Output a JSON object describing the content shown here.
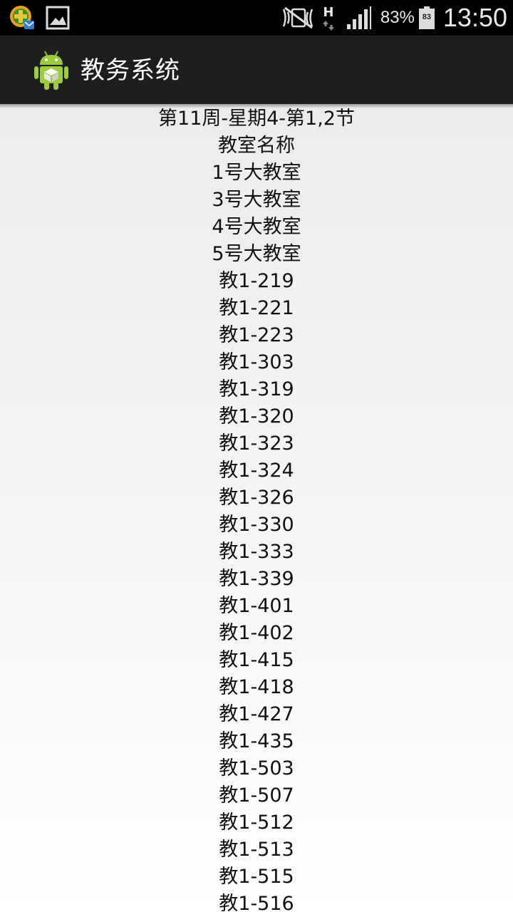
{
  "status_bar": {
    "battery_percent": "83%",
    "battery_level": "83",
    "network_type": "H",
    "time": "13:50",
    "icons": [
      "app-notification-icon",
      "gallery-notification-icon",
      "mute-icon",
      "network-h-icon",
      "signal-icon",
      "battery-icon"
    ]
  },
  "action_bar": {
    "title": "教务系统",
    "icon": "android-app-icon"
  },
  "schedule": {
    "heading": "第11周-星期4-第1,2节",
    "column_header": "教室名称",
    "rooms": [
      "1号大教室",
      "3号大教室",
      "4号大教室",
      "5号大教室",
      "教1-219",
      "教1-221",
      "教1-223",
      "教1-303",
      "教1-319",
      "教1-320",
      "教1-323",
      "教1-324",
      "教1-326",
      "教1-330",
      "教1-333",
      "教1-339",
      "教1-401",
      "教1-402",
      "教1-415",
      "教1-418",
      "教1-427",
      "教1-435",
      "教1-503",
      "教1-507",
      "教1-512",
      "教1-513",
      "教1-515",
      "教1-516"
    ]
  },
  "colors": {
    "status_bar": "#000000",
    "action_bar": "#1d1d1d",
    "content_bg": "#f2f2f2",
    "text": "#111111"
  }
}
